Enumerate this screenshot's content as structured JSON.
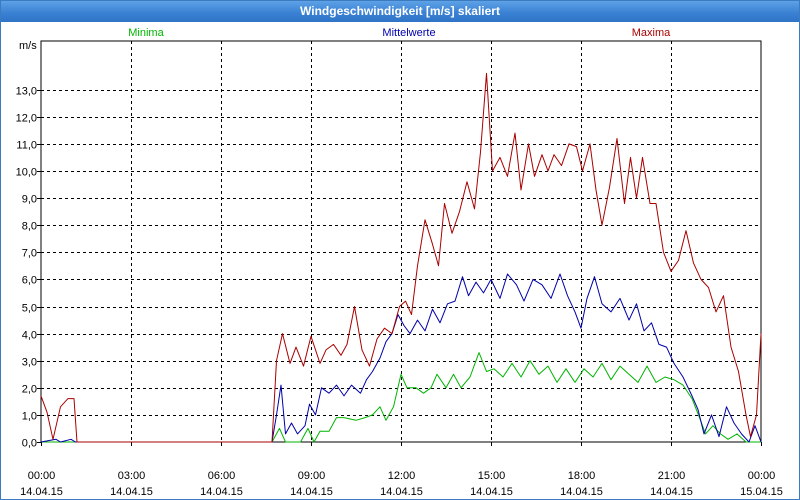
{
  "window": {
    "title": "Windgeschwindigkeit [m/s] skaliert"
  },
  "chart_data": {
    "type": "line",
    "title": "Windgeschwindigkeit [m/s] skaliert",
    "ylabel": "m/s",
    "ylim": [
      0,
      13.5
    ],
    "xlim": [
      0,
      24
    ],
    "grid": true,
    "legend": "top",
    "yticks": [
      "0,0",
      "1,0",
      "2,0",
      "3,0",
      "4,0",
      "5,0",
      "6,0",
      "7,0",
      "8,0",
      "9,0",
      "10,0",
      "11,0",
      "12,0",
      "13,0"
    ],
    "xticks": [
      {
        "time": "00:00",
        "date": "14.04.15"
      },
      {
        "time": "03:00",
        "date": "14.04.15"
      },
      {
        "time": "06:00",
        "date": "14.04.15"
      },
      {
        "time": "09:00",
        "date": "14.04.15"
      },
      {
        "time": "12:00",
        "date": "14.04.15"
      },
      {
        "time": "15:00",
        "date": "14.04.15"
      },
      {
        "time": "18:00",
        "date": "14.04.15"
      },
      {
        "time": "21:00",
        "date": "14.04.15"
      },
      {
        "time": "00:00",
        "date": "15.04.15"
      }
    ],
    "series": [
      {
        "name": "Minima",
        "color": "#00b400",
        "points": [
          [
            0,
            0
          ],
          [
            1.3,
            0
          ],
          [
            7.7,
            0
          ],
          [
            7.95,
            0.5
          ],
          [
            8.15,
            0
          ],
          [
            8.35,
            0
          ],
          [
            8.65,
            0
          ],
          [
            8.9,
            0.5
          ],
          [
            9.1,
            0
          ],
          [
            9.3,
            0.4
          ],
          [
            9.6,
            0.4
          ],
          [
            9.85,
            0.9
          ],
          [
            10.1,
            0.9
          ],
          [
            10.5,
            0.8
          ],
          [
            10.8,
            0.9
          ],
          [
            11.05,
            1.0
          ],
          [
            11.3,
            1.3
          ],
          [
            11.5,
            0.8
          ],
          [
            11.75,
            1.3
          ],
          [
            12.0,
            2.5
          ],
          [
            12.2,
            2.0
          ],
          [
            12.5,
            2.0
          ],
          [
            12.75,
            1.8
          ],
          [
            13.0,
            2.0
          ],
          [
            13.2,
            2.5
          ],
          [
            13.5,
            2.0
          ],
          [
            13.75,
            2.5
          ],
          [
            14.0,
            2.0
          ],
          [
            14.3,
            2.4
          ],
          [
            14.6,
            3.3
          ],
          [
            14.85,
            2.6
          ],
          [
            15.1,
            2.7
          ],
          [
            15.4,
            2.4
          ],
          [
            15.7,
            2.9
          ],
          [
            16.0,
            2.4
          ],
          [
            16.3,
            3.0
          ],
          [
            16.6,
            2.5
          ],
          [
            16.9,
            2.8
          ],
          [
            17.2,
            2.2
          ],
          [
            17.5,
            2.7
          ],
          [
            17.8,
            2.2
          ],
          [
            18.1,
            2.7
          ],
          [
            18.4,
            2.4
          ],
          [
            18.7,
            2.9
          ],
          [
            19.0,
            2.3
          ],
          [
            19.3,
            2.8
          ],
          [
            19.6,
            2.5
          ],
          [
            19.9,
            2.2
          ],
          [
            20.2,
            2.8
          ],
          [
            20.5,
            2.2
          ],
          [
            20.8,
            2.4
          ],
          [
            21.1,
            2.3
          ],
          [
            21.4,
            2.1
          ],
          [
            21.7,
            1.6
          ],
          [
            21.95,
            0.9
          ],
          [
            22.15,
            0.3
          ],
          [
            22.4,
            0.6
          ],
          [
            22.65,
            0.3
          ],
          [
            22.9,
            0.1
          ],
          [
            23.2,
            0.3
          ],
          [
            23.5,
            0.0
          ],
          [
            23.75,
            0.0
          ],
          [
            24,
            0.0
          ]
        ]
      },
      {
        "name": "Mittelwerte",
        "color": "#0000aa",
        "points": [
          [
            0,
            0
          ],
          [
            0.5,
            0.1
          ],
          [
            0.65,
            0
          ],
          [
            1.0,
            0.1
          ],
          [
            1.15,
            0
          ],
          [
            1.3,
            0
          ],
          [
            7.7,
            0
          ],
          [
            7.85,
            1.0
          ],
          [
            8.0,
            2.1
          ],
          [
            8.15,
            0.3
          ],
          [
            8.35,
            0.7
          ],
          [
            8.55,
            0.3
          ],
          [
            8.8,
            0.6
          ],
          [
            8.95,
            1.4
          ],
          [
            9.15,
            1.0
          ],
          [
            9.35,
            2.0
          ],
          [
            9.6,
            1.8
          ],
          [
            9.85,
            2.1
          ],
          [
            10.1,
            1.7
          ],
          [
            10.35,
            2.1
          ],
          [
            10.65,
            1.8
          ],
          [
            10.85,
            2.3
          ],
          [
            11.05,
            2.6
          ],
          [
            11.3,
            3.1
          ],
          [
            11.5,
            3.7
          ],
          [
            11.7,
            4.0
          ],
          [
            11.9,
            4.7
          ],
          [
            12.1,
            4.3
          ],
          [
            12.3,
            4.0
          ],
          [
            12.55,
            4.5
          ],
          [
            12.8,
            4.1
          ],
          [
            13.05,
            4.9
          ],
          [
            13.3,
            4.4
          ],
          [
            13.55,
            5.1
          ],
          [
            13.8,
            5.2
          ],
          [
            14.05,
            6.1
          ],
          [
            14.25,
            5.4
          ],
          [
            14.5,
            5.9
          ],
          [
            14.75,
            5.5
          ],
          [
            15.0,
            6.0
          ],
          [
            15.3,
            5.3
          ],
          [
            15.55,
            6.2
          ],
          [
            15.85,
            5.8
          ],
          [
            16.1,
            5.2
          ],
          [
            16.4,
            6.0
          ],
          [
            16.7,
            5.8
          ],
          [
            17.0,
            5.3
          ],
          [
            17.3,
            6.2
          ],
          [
            17.55,
            5.4
          ],
          [
            17.8,
            4.8
          ],
          [
            18.0,
            4.2
          ],
          [
            18.2,
            5.3
          ],
          [
            18.45,
            6.1
          ],
          [
            18.7,
            5.1
          ],
          [
            19.0,
            4.8
          ],
          [
            19.3,
            5.3
          ],
          [
            19.6,
            4.5
          ],
          [
            19.85,
            5.1
          ],
          [
            20.1,
            4.1
          ],
          [
            20.35,
            4.4
          ],
          [
            20.6,
            3.6
          ],
          [
            20.85,
            3.5
          ],
          [
            21.1,
            2.9
          ],
          [
            21.4,
            2.4
          ],
          [
            21.7,
            1.7
          ],
          [
            21.9,
            1.2
          ],
          [
            22.1,
            0.3
          ],
          [
            22.35,
            1.0
          ],
          [
            22.6,
            0.2
          ],
          [
            22.85,
            1.3
          ],
          [
            23.1,
            0.7
          ],
          [
            23.35,
            0.3
          ],
          [
            23.6,
            0.0
          ],
          [
            23.8,
            0.6
          ],
          [
            24,
            0.0
          ]
        ]
      },
      {
        "name": "Maxima",
        "color": "#aa0000",
        "points": [
          [
            0,
            1.7
          ],
          [
            0.2,
            1.1
          ],
          [
            0.4,
            0.1
          ],
          [
            0.65,
            1.3
          ],
          [
            0.9,
            1.6
          ],
          [
            1.1,
            1.6
          ],
          [
            1.2,
            0
          ],
          [
            1.35,
            0
          ],
          [
            7.7,
            0
          ],
          [
            7.85,
            3.0
          ],
          [
            8.05,
            4.0
          ],
          [
            8.3,
            2.9
          ],
          [
            8.5,
            3.5
          ],
          [
            8.75,
            2.8
          ],
          [
            9.0,
            3.9
          ],
          [
            9.3,
            2.9
          ],
          [
            9.5,
            3.4
          ],
          [
            9.75,
            3.6
          ],
          [
            10.0,
            3.2
          ],
          [
            10.2,
            3.6
          ],
          [
            10.45,
            5.0
          ],
          [
            10.7,
            3.4
          ],
          [
            10.95,
            2.8
          ],
          [
            11.2,
            3.8
          ],
          [
            11.45,
            4.2
          ],
          [
            11.7,
            4.0
          ],
          [
            11.95,
            5.0
          ],
          [
            12.15,
            5.2
          ],
          [
            12.35,
            4.7
          ],
          [
            12.55,
            6.5
          ],
          [
            12.8,
            8.2
          ],
          [
            13.05,
            7.3
          ],
          [
            13.25,
            6.5
          ],
          [
            13.45,
            8.8
          ],
          [
            13.7,
            7.7
          ],
          [
            13.95,
            8.5
          ],
          [
            14.2,
            9.6
          ],
          [
            14.45,
            8.6
          ],
          [
            14.65,
            10.7
          ],
          [
            14.85,
            13.6
          ],
          [
            15.05,
            10.0
          ],
          [
            15.3,
            10.5
          ],
          [
            15.55,
            9.8
          ],
          [
            15.8,
            11.4
          ],
          [
            16.0,
            9.3
          ],
          [
            16.25,
            11.0
          ],
          [
            16.45,
            9.8
          ],
          [
            16.7,
            10.6
          ],
          [
            16.9,
            10.0
          ],
          [
            17.1,
            10.6
          ],
          [
            17.35,
            10.2
          ],
          [
            17.6,
            11.0
          ],
          [
            17.85,
            10.9
          ],
          [
            18.05,
            10.0
          ],
          [
            18.3,
            11.0
          ],
          [
            18.5,
            9.3
          ],
          [
            18.7,
            8.0
          ],
          [
            18.95,
            9.4
          ],
          [
            19.2,
            11.2
          ],
          [
            19.45,
            8.8
          ],
          [
            19.65,
            10.5
          ],
          [
            19.85,
            9.0
          ],
          [
            20.05,
            10.5
          ],
          [
            20.3,
            8.8
          ],
          [
            20.5,
            8.8
          ],
          [
            20.75,
            7.0
          ],
          [
            21.0,
            6.3
          ],
          [
            21.25,
            6.7
          ],
          [
            21.5,
            7.8
          ],
          [
            21.75,
            6.6
          ],
          [
            22.0,
            6.0
          ],
          [
            22.25,
            5.7
          ],
          [
            22.5,
            4.8
          ],
          [
            22.75,
            5.4
          ],
          [
            23.0,
            3.5
          ],
          [
            23.25,
            2.6
          ],
          [
            23.5,
            1.0
          ],
          [
            23.65,
            0.2
          ],
          [
            23.85,
            1.0
          ],
          [
            24.0,
            4.0
          ]
        ]
      }
    ]
  }
}
